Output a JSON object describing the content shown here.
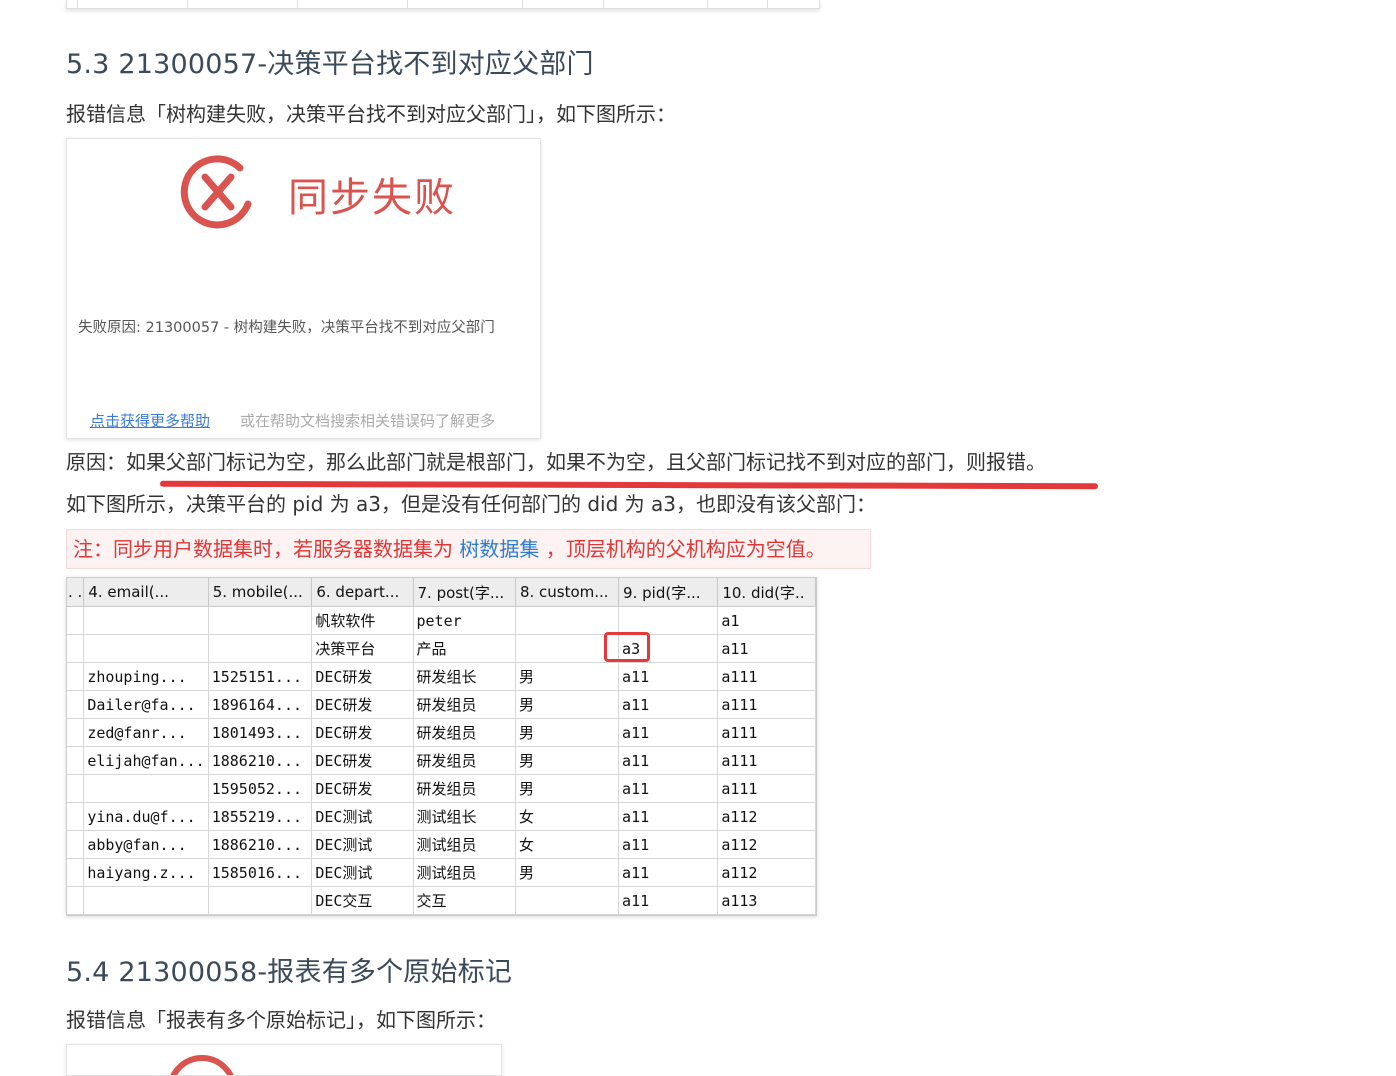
{
  "section_53": {
    "heading": "5.3 21300057-决策平台找不到对应父部门",
    "error_info": "报错信息「树构建失败，决策平台找不到对应父部门」，如下图所示：",
    "dialog": {
      "title": "同步失败",
      "reason": "失败原因: 21300057 - 树构建失败，决策平台找不到对应父部门",
      "help_link": "点击获得更多帮助",
      "help_tip": "或在帮助文档搜索相关错误码了解更多"
    },
    "cause": "原因：如果父部门标记为空，那么此部门就是根部门，如果不为空，且父部门标记找不到对应的部门，则报错。",
    "example": "如下图所示，决策平台的 pid 为 a3，但是没有任何部门的 did 为 a3，也即没有该父部门：",
    "note": {
      "prefix": "注：同步用户数据集时，若服务器数据集为 ",
      "link": "树数据集",
      "suffix": " ，顶层机构的父机构应为空值。"
    }
  },
  "data_table": {
    "columns": [
      ". .",
      "4. email(...",
      "5. mobile(...",
      "6. depart...",
      "7. post(字...",
      "8. custom...",
      "9. pid(字...",
      "10. did(字.."
    ],
    "rows": [
      [
        "",
        "",
        "",
        "帆软软件",
        "peter",
        "",
        "",
        "a1"
      ],
      [
        "",
        "",
        "",
        "决策平台",
        "产品",
        "",
        "a3",
        "a11"
      ],
      [
        "",
        "zhouping...",
        "1525151...",
        "DEC研发",
        "研发组长",
        "男",
        "a11",
        "a111"
      ],
      [
        "",
        "Dailer@fa...",
        "1896164...",
        "DEC研发",
        "研发组员",
        "男",
        "a11",
        "a111"
      ],
      [
        "",
        "zed@fanr...",
        "1801493...",
        "DEC研发",
        "研发组员",
        "男",
        "a11",
        "a111"
      ],
      [
        "",
        "elijah@fan...",
        "1886210...",
        "DEC研发",
        "研发组员",
        "男",
        "a11",
        "a111"
      ],
      [
        "",
        "",
        "1595052...",
        "DEC研发",
        "研发组员",
        "男",
        "a11",
        "a111"
      ],
      [
        "",
        "yina.du@f...",
        "1855219...",
        "DEC测试",
        "测试组长",
        "女",
        "a11",
        "a112"
      ],
      [
        "",
        "abby@fan...",
        "1886210...",
        "DEC测试",
        "测试组员",
        "女",
        "a11",
        "a112"
      ],
      [
        "",
        "haiyang.z...",
        "1585016...",
        "DEC测试",
        "测试组员",
        "男",
        "a11",
        "a112"
      ],
      [
        "",
        "",
        "",
        "DEC交互",
        "交互",
        "",
        "a11",
        "a113"
      ]
    ]
  },
  "section_54": {
    "heading": "5.4 21300058-报表有多个原始标记",
    "error_info": "报错信息「报表有多个原始标记」，如下图所示："
  },
  "colors": {
    "error_red": "#d9534f",
    "highlight_red": "#e5383b",
    "link_blue": "#2f7dd1"
  },
  "icons": [
    "fail-x-circle-icon"
  ]
}
